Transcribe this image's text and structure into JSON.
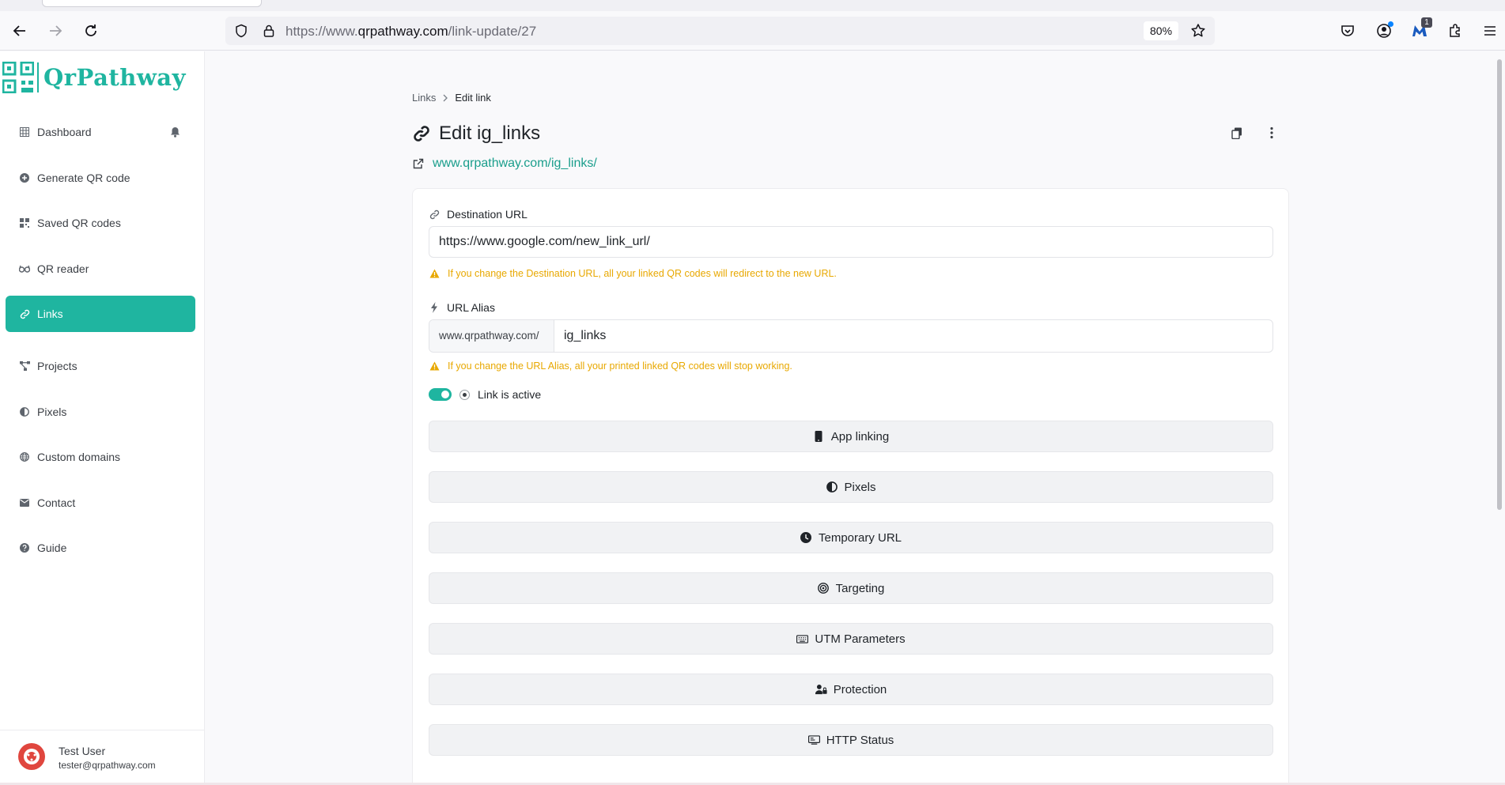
{
  "browser": {
    "url_prefix": "https://www.",
    "url_host": "qrpathway.com",
    "url_path": "/link-update/27",
    "zoom": "80%",
    "extension_badge": "1"
  },
  "sidebar": {
    "brand": "QrPathway",
    "items": [
      {
        "label": "Dashboard",
        "icon": "grid-icon"
      },
      {
        "label": "Generate QR code",
        "icon": "plus-circle-icon"
      },
      {
        "label": "Saved QR codes",
        "icon": "qr-icon"
      },
      {
        "label": "QR reader",
        "icon": "glasses-icon"
      },
      {
        "label": "Links",
        "icon": "link-icon",
        "active": true
      },
      {
        "label": "Projects",
        "icon": "project-diagram-icon"
      },
      {
        "label": "Pixels",
        "icon": "adjust-icon"
      },
      {
        "label": "Custom domains",
        "icon": "globe-icon"
      },
      {
        "label": "Contact",
        "icon": "envelope-icon"
      },
      {
        "label": "Guide",
        "icon": "question-circle-icon"
      }
    ],
    "user": {
      "name": "Test User",
      "email": "tester@qrpathway.com"
    }
  },
  "main": {
    "breadcrumb": {
      "parent": "Links",
      "current": "Edit link"
    },
    "title": "Edit ig_links",
    "short_url": "www.qrpathway.com/ig_links/",
    "destination": {
      "label": "Destination URL",
      "value": "https://www.google.com/new_link_url/",
      "warning": "If you change the Destination URL, all your linked QR codes will redirect to the new URL."
    },
    "alias": {
      "label": "URL Alias",
      "prefix": "www.qrpathway.com/",
      "value": "ig_links",
      "warning": "If you change the URL Alias, all your printed linked QR codes will stop working."
    },
    "active_label": "Link is active",
    "sections": [
      {
        "label": "App linking",
        "icon": "mobile-icon"
      },
      {
        "label": "Pixels",
        "icon": "adjust-icon"
      },
      {
        "label": "Temporary URL",
        "icon": "clock-icon"
      },
      {
        "label": "Targeting",
        "icon": "bullseye-icon"
      },
      {
        "label": "UTM Parameters",
        "icon": "keyboard-icon"
      },
      {
        "label": "Protection",
        "icon": "user-lock-icon"
      },
      {
        "label": "HTTP Status",
        "icon": "server-icon"
      }
    ]
  },
  "colors": {
    "accent": "#1fb5a0",
    "warning": "#e8a800",
    "link": "#1a9e8c"
  }
}
